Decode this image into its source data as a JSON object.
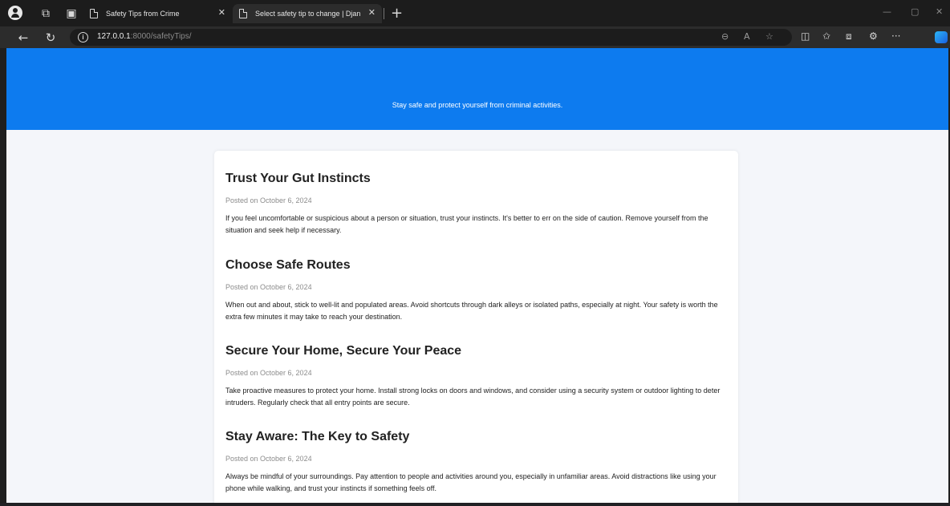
{
  "browser": {
    "tabs": [
      {
        "title": "Safety Tips from Crime",
        "active": false
      },
      {
        "title": "Select safety tip to change | Djan",
        "active": true
      }
    ],
    "url_host": "127.0.0.1",
    "url_rest": ":8000/safetyTips/"
  },
  "page": {
    "tagline": "Stay safe and protect yourself from criminal activities.",
    "tips": [
      {
        "title": "Trust Your Gut Instincts",
        "date": "Posted on October 6, 2024",
        "body": "If you feel uncomfortable or suspicious about a person or situation, trust your instincts. It's better to err on the side of caution. Remove yourself from the situation and seek help if necessary."
      },
      {
        "title": "Choose Safe Routes",
        "date": "Posted on October 6, 2024",
        "body": "When out and about, stick to well-lit and populated areas. Avoid shortcuts through dark alleys or isolated paths, especially at night. Your safety is worth the extra few minutes it may take to reach your destination."
      },
      {
        "title": "Secure Your Home, Secure Your Peace",
        "date": "Posted on October 6, 2024",
        "body": "Take proactive measures to protect your home. Install strong locks on doors and windows, and consider using a security system or outdoor lighting to deter intruders. Regularly check that all entry points are secure."
      },
      {
        "title": "Stay Aware: The Key to Safety",
        "date": "Posted on October 6, 2024",
        "body": "Always be mindful of your surroundings. Pay attention to people and activities around you, especially in unfamiliar areas. Avoid distractions like using your phone while walking, and trust your instincts if something feels off."
      }
    ]
  },
  "colors": {
    "header_blue": "#0d7bef",
    "page_bg": "#f4f6fa",
    "card_bg": "#ffffff"
  }
}
